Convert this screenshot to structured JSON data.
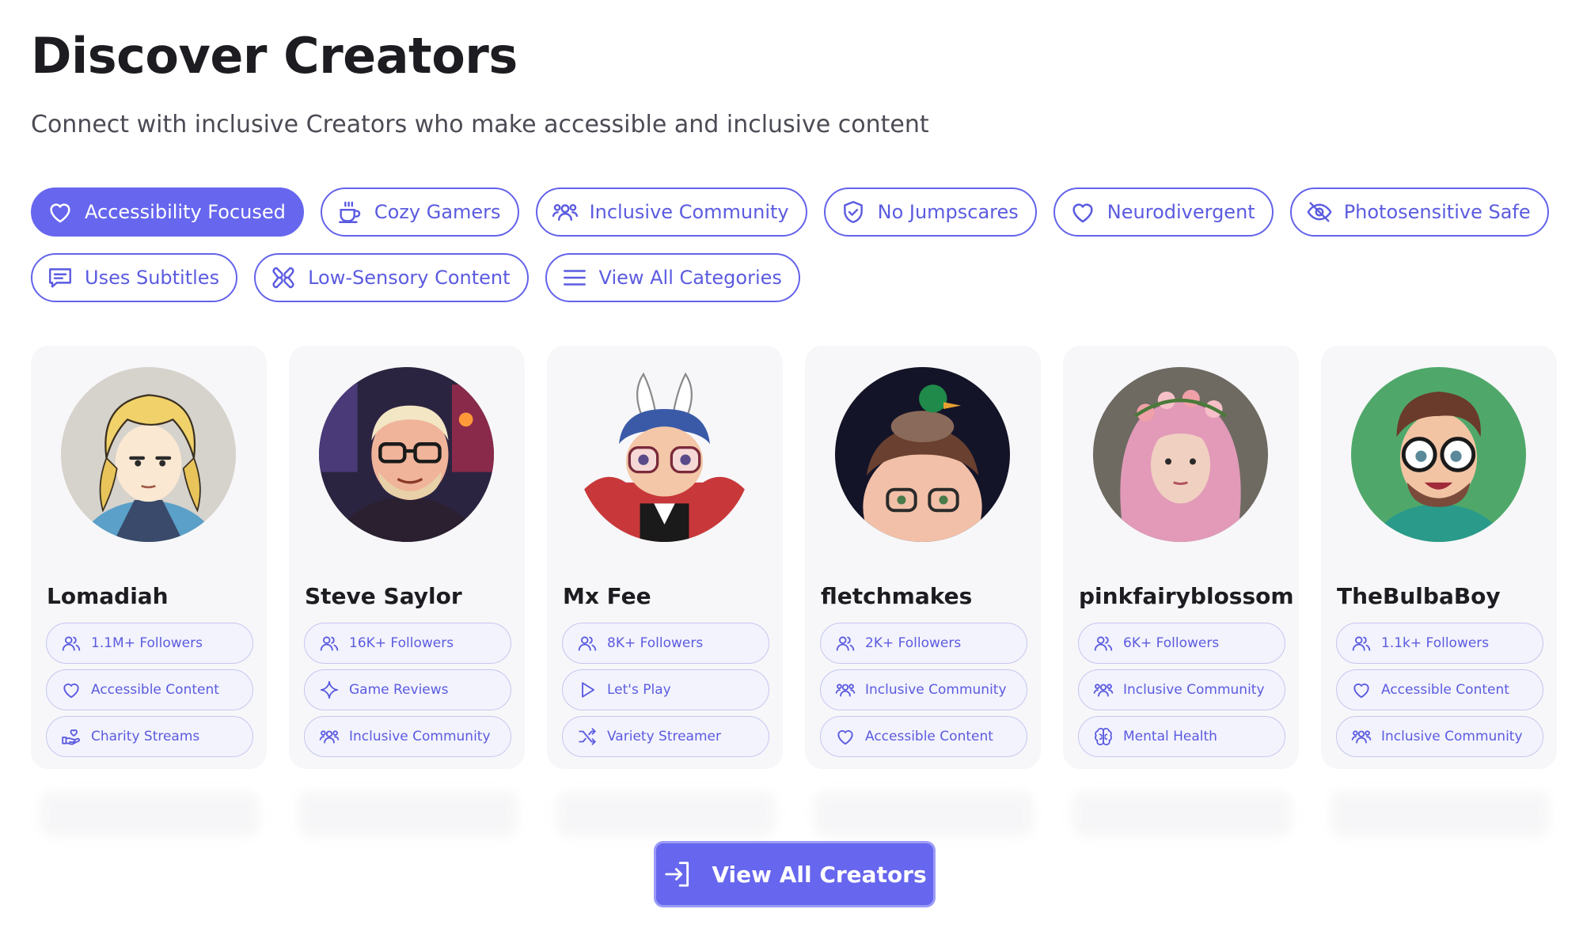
{
  "page": {
    "title": "Discover Creators",
    "subtitle": "Connect with inclusive Creators who make accessible and inclusive content"
  },
  "colors": {
    "accent": "#6666EE",
    "chip_text": "#5B5BE0",
    "tag_bg": "#F3F3FD",
    "card_bg": "#F7F7F9"
  },
  "filters": [
    {
      "label": "Accessibility Focused",
      "icon": "heart-icon",
      "active": true
    },
    {
      "label": "Cozy Gamers",
      "icon": "coffee-cup-icon",
      "active": false
    },
    {
      "label": "Inclusive Community",
      "icon": "community-icon",
      "active": false
    },
    {
      "label": "No Jumpscares",
      "icon": "shield-check-icon",
      "active": false
    },
    {
      "label": "Neurodivergent",
      "icon": "heart-icon",
      "active": false
    },
    {
      "label": "Photosensitive Safe",
      "icon": "eye-off-icon",
      "active": false
    },
    {
      "label": "Uses Subtitles",
      "icon": "subtitles-icon",
      "active": false
    },
    {
      "label": "Low-Sensory Content",
      "icon": "low-sensory-icon",
      "active": false
    },
    {
      "label": "View All Categories",
      "icon": "menu-icon",
      "active": false
    }
  ],
  "creators": [
    {
      "name": "Lomadiah",
      "avatar": "blonde-cartoon-avatar",
      "tags": [
        {
          "label": "1.1M+ Followers",
          "icon": "users-icon"
        },
        {
          "label": "Accessible Content",
          "icon": "heart-icon"
        },
        {
          "label": "Charity Streams",
          "icon": "charity-hand-icon"
        }
      ]
    },
    {
      "name": "Steve Saylor",
      "avatar": "bearded-man-glasses-avatar",
      "tags": [
        {
          "label": "16K+ Followers",
          "icon": "users-icon"
        },
        {
          "label": "Game Reviews",
          "icon": "sparkle-icon"
        },
        {
          "label": "Inclusive Community",
          "icon": "community-icon"
        }
      ]
    },
    {
      "name": "Mx Fee",
      "avatar": "bunny-ears-cartoon-avatar",
      "tags": [
        {
          "label": "8K+ Followers",
          "icon": "users-icon"
        },
        {
          "label": "Let's Play",
          "icon": "play-icon"
        },
        {
          "label": "Variety Streamer",
          "icon": "shuffle-icon"
        }
      ]
    },
    {
      "name": "fletchmakes",
      "avatar": "duck-on-head-avatar",
      "tags": [
        {
          "label": "2K+ Followers",
          "icon": "users-icon"
        },
        {
          "label": "Inclusive Community",
          "icon": "community-icon"
        },
        {
          "label": "Accessible Content",
          "icon": "heart-icon"
        }
      ]
    },
    {
      "name": "pinkfairyblossom",
      "avatar": "pink-hair-flower-crown-avatar",
      "tags": [
        {
          "label": "6K+ Followers",
          "icon": "users-icon"
        },
        {
          "label": "Inclusive Community",
          "icon": "community-icon"
        },
        {
          "label": "Mental Health",
          "icon": "brain-icon"
        }
      ]
    },
    {
      "name": "TheBulbaBoy",
      "avatar": "cartoon-glasses-green-avatar",
      "tags": [
        {
          "label": "1.1k+ Followers",
          "icon": "users-icon"
        },
        {
          "label": "Accessible Content",
          "icon": "heart-icon"
        },
        {
          "label": "Inclusive Community",
          "icon": "community-icon"
        }
      ]
    }
  ],
  "cta": {
    "label": "View All Creators",
    "icon": "sign-in-arrow-icon"
  }
}
